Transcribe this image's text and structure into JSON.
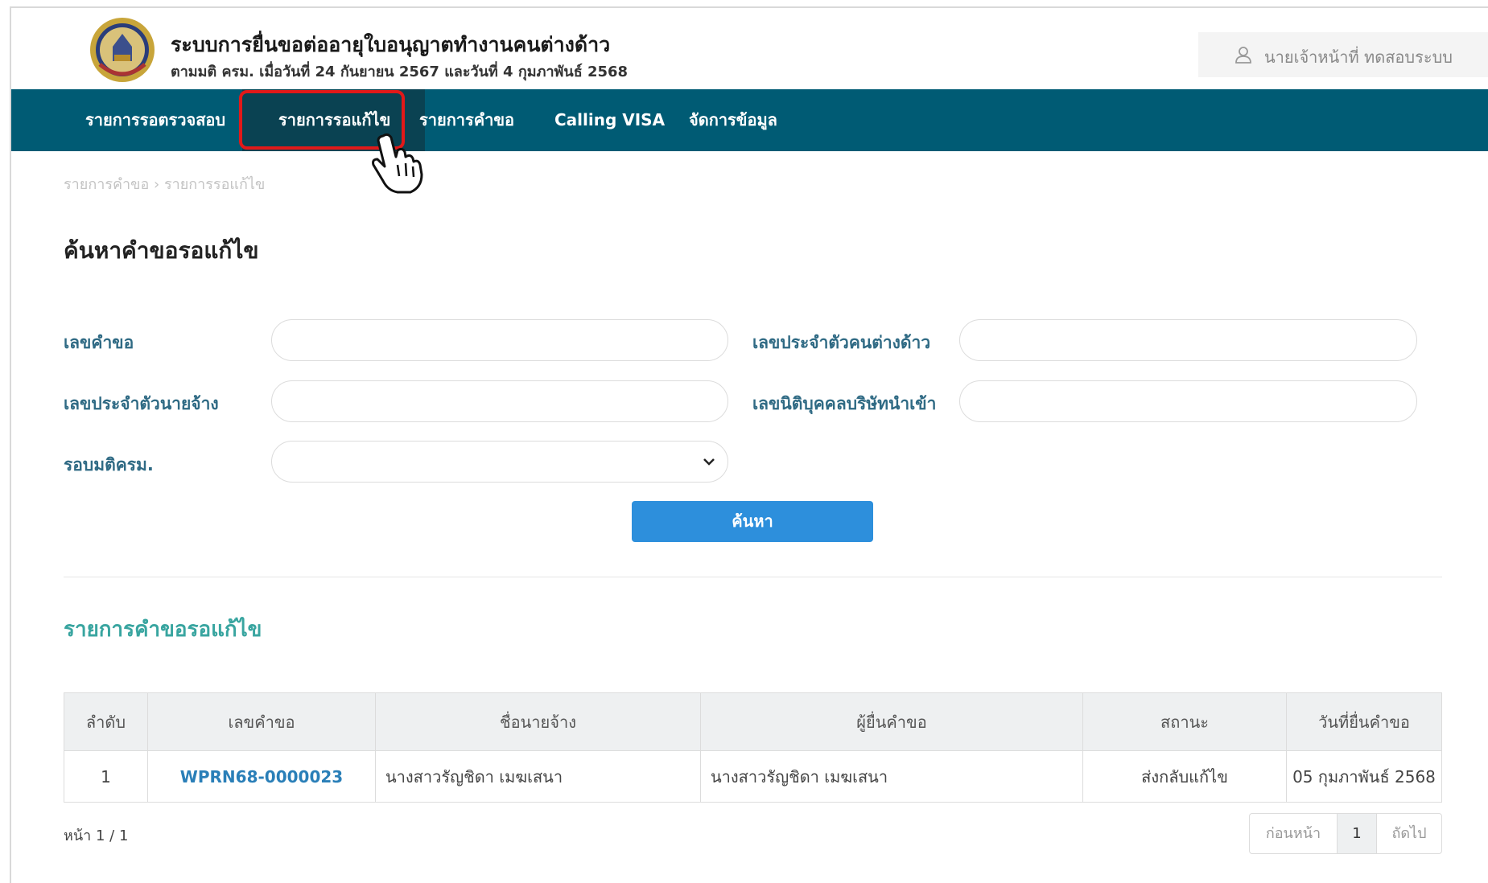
{
  "header": {
    "title": "ระบบการยื่นขอต่ออายุใบอนุญาตทำงานคนต่างด้าว",
    "subtitle": "ตามมติ ครม. เมื่อวันที่ 24 กันยายน 2567 และวันที่ 4 กุมภาพันธ์ 2568",
    "user_name": "นายเจ้าหน้าที่ ทดสอบระบบ"
  },
  "nav": {
    "items": [
      "รายการรอตรวจสอบ",
      "รายการรอแก้ไข",
      "รายการคำขอ",
      "Calling VISA",
      "จัดการข้อมูล"
    ],
    "active_index": 1
  },
  "breadcrumb": {
    "parent": "รายการคำขอ",
    "separator": "›",
    "current": "รายการรอแก้ไข"
  },
  "search": {
    "title": "ค้นหาคำขอรอแก้ไข",
    "request_no_label": "เลขคำขอ",
    "request_no_value": "",
    "foreigner_id_label": "เลขประจำตัวคนต่างด้าว",
    "foreigner_id_value": "",
    "employer_id_label": "เลขประจำตัวนายจ้าง",
    "employer_id_value": "",
    "company_id_label": "เลขนิติบุคคลบริษัทนำเข้า",
    "company_id_value": "",
    "cabinet_round_label": "รอบมติครม.",
    "cabinet_round_value": "",
    "button": "ค้นหา"
  },
  "results": {
    "title": "รายการคำขอรอแก้ไข",
    "columns": [
      "ลำดับ",
      "เลขคำขอ",
      "ชื่อนายจ้าง",
      "ผู้ยื่นคำขอ",
      "สถานะ",
      "วันที่ยื่นคำขอ"
    ],
    "rows": [
      {
        "seq": "1",
        "request_no": "WPRN68-0000023",
        "employer": "นางสาวรัญชิดา เมฆเสนา",
        "applicant": "นางสาวรัญชิดา เมฆเสนา",
        "status": "ส่งกลับแก้ไข",
        "date": "05 กุมภาพันธ์ 2568"
      }
    ]
  },
  "pagination": {
    "info": "หน้า 1 / 1",
    "prev": "ก่อนหน้า",
    "current": "1",
    "next": "ถัดไป"
  },
  "colors": {
    "nav_bg": "#005b74",
    "nav_active": "#0a4252",
    "highlight": "#e11919",
    "button": "#2d8fdc",
    "label": "#2f6a84",
    "list_title": "#39a5a0"
  }
}
